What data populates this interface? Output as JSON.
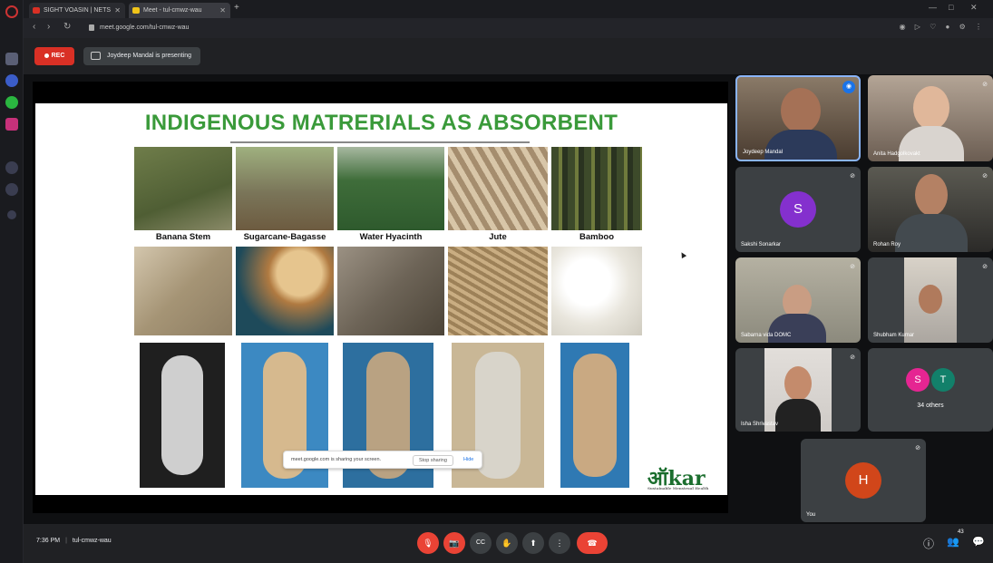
{
  "browser": {
    "tabs": [
      {
        "label": "SIGHT VOASIN | NETS",
        "favicon_color": "#d93025"
      },
      {
        "label": "Meet - tul-cmwz-wau",
        "favicon_color": "#f0c419"
      }
    ],
    "new_tab": "+",
    "url": "meet.google.com/tul-cmwz-wau",
    "window_controls": [
      "—",
      "□",
      "✕"
    ]
  },
  "meet": {
    "rec_label": "REC",
    "presenting_text": "Joydeep Mandal is presenting",
    "meeting_time": "7:36 PM",
    "meeting_code": "tul-cmwz-wau"
  },
  "slide": {
    "title": "INDIGENOUS MATRERIALS AS ABSORBENT",
    "materials": [
      {
        "label": "Banana Stem",
        "raw_color": "#5b6b3a",
        "fiber_color": "#b9ab8e"
      },
      {
        "label": "Sugarcane-Bagasse",
        "raw_color": "#7a7559",
        "fiber_color": "#c3a16a"
      },
      {
        "label": "Water Hyacinth",
        "raw_color": "#3f6d3a",
        "fiber_color": "#7d7466"
      },
      {
        "label": "Jute",
        "raw_color": "#a58d6e",
        "fiber_color": "#b59a70"
      },
      {
        "label": "Bamboo",
        "raw_color": "#3d4a2a",
        "fiber_color": "#efeee8"
      }
    ],
    "pads": [
      {
        "pad_color": "#cfcfcf",
        "bg_color": "#1f1f1f"
      },
      {
        "pad_color": "#d6b98e",
        "bg_color": "#3c89c2"
      },
      {
        "pad_color": "#b9a282",
        "bg_color": "#2d6f9f"
      },
      {
        "pad_color": "#d8d4ca",
        "bg_color": "#c9b796"
      },
      {
        "pad_color": "#c9a982",
        "bg_color": "#2f79b3"
      }
    ],
    "logo_text": "ऑkar",
    "logo_subtext": "Sustainable Menstrual Health"
  },
  "share_notice": {
    "message": "meet.google.com is sharing your screen.",
    "stop_label": "Stop sharing",
    "hide_label": "Hide"
  },
  "participants": [
    {
      "name": "Joydeep Mandal",
      "type": "video",
      "bg": "#5a4a3c",
      "active": true
    },
    {
      "name": "Anita Hadgolkovakt",
      "type": "video",
      "bg": "#6b5d52",
      "active": false
    },
    {
      "name": "Sakshi Sonarkar",
      "type": "avatar",
      "initial": "S",
      "avatar_color": "#8430ce",
      "active": false
    },
    {
      "name": "Rohan Roy",
      "type": "video",
      "bg": "#3b3a36",
      "active": false
    },
    {
      "name": "Sabarna vida DOMC",
      "type": "video",
      "bg": "#8c8a7d",
      "active": false
    },
    {
      "name": "Shubham Kumar",
      "type": "video",
      "bg": "#aba6a0",
      "active": false
    },
    {
      "name": "Isha Shrivastav",
      "type": "video",
      "bg": "#cfcbc7",
      "active": false
    },
    {
      "name": "34 others",
      "type": "group",
      "initials": [
        "S",
        "T"
      ],
      "colors": [
        "#e52592",
        "#12806a"
      ],
      "active": false
    },
    {
      "name": "You",
      "type": "avatar",
      "initial": "H",
      "avatar_color": "#d1461a",
      "active": false
    }
  ],
  "controls": {
    "mic": "🎙",
    "camera": "📷",
    "captions": "CC",
    "raise_hand": "✋",
    "present": "⬆",
    "more": "⋮",
    "end_call": "☎",
    "info": "ⓘ",
    "people": "👥",
    "people_count": "43",
    "chat": "💬"
  }
}
